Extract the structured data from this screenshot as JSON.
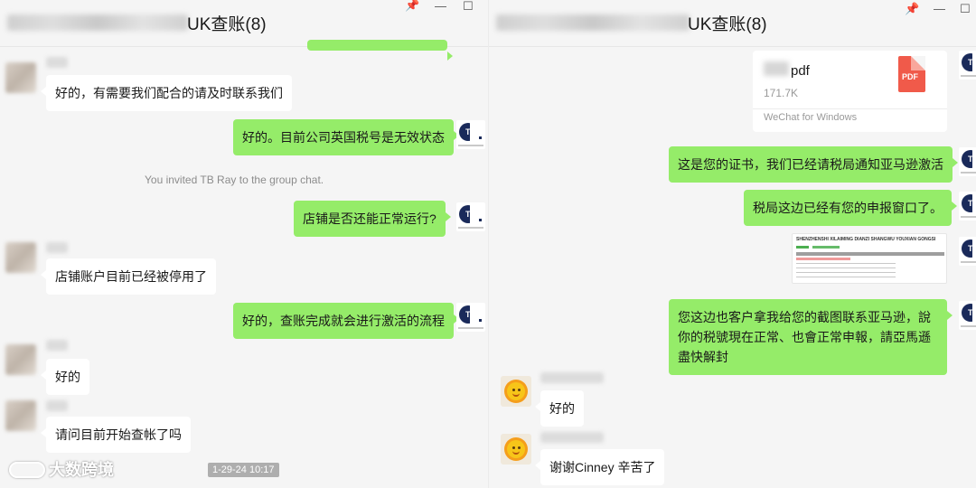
{
  "colors": {
    "outgoing_bubble": "#95ec69",
    "incoming_bubble": "#ffffff",
    "background": "#f5f5f5"
  },
  "left_window": {
    "title": "UK查账(8)",
    "controls": {
      "pin": "📌",
      "minimize": "—",
      "maximize": "☐"
    },
    "messages": [
      {
        "from": "other",
        "text": "好的，有需要我们配合的请及时联系我们"
      },
      {
        "from": "me",
        "text": "好的。目前公司英国税号是无效状态"
      },
      {
        "type": "system",
        "text": "You invited TB Ray to the group chat."
      },
      {
        "from": "me",
        "text": "店铺是否还能正常运行?"
      },
      {
        "from": "other",
        "text": "店铺账户目前已经被停用了"
      },
      {
        "from": "me",
        "text": "好的，查账完成就会进行激活的流程"
      },
      {
        "from": "other",
        "text": "好的"
      },
      {
        "from": "other",
        "text": "请问目前开始查帐了吗"
      }
    ],
    "watermark": "大数跨境",
    "timestamp": "1-29-24 10:17",
    "avatar_icons": {
      "me": "tb-logo-icon",
      "other": "blurred-avatar"
    }
  },
  "right_window": {
    "title": "UK查账(8)",
    "controls": {
      "pin": "📌",
      "minimize": "—",
      "maximize": "☐"
    },
    "file": {
      "name": "pdf",
      "size": "171.7K",
      "source": "WeChat for Windows",
      "icon_label": "PDF"
    },
    "messages": [
      {
        "from": "me",
        "text": "这是您的证书，我们已经请税局通知亚马逊激活"
      },
      {
        "from": "me",
        "text": "税局这边已经有您的申报窗口了。"
      },
      {
        "from": "me",
        "type": "image",
        "caption": "SHENZHENSHI XILAIMING DIANZI SHANGWU YOUXIAN GONGSI"
      },
      {
        "from": "me",
        "text": "您这边也客户拿我给您的截图联系亚马逊，說你的税號現在正常、也會正常申報，請亞馬遜盡快解封"
      },
      {
        "from": "other",
        "text": "好的"
      },
      {
        "from": "other",
        "text": "谢谢Cinney 辛苦了"
      }
    ],
    "avatar_icons": {
      "me": "tb-logo-icon",
      "other": "sun-avatar-icon"
    }
  }
}
